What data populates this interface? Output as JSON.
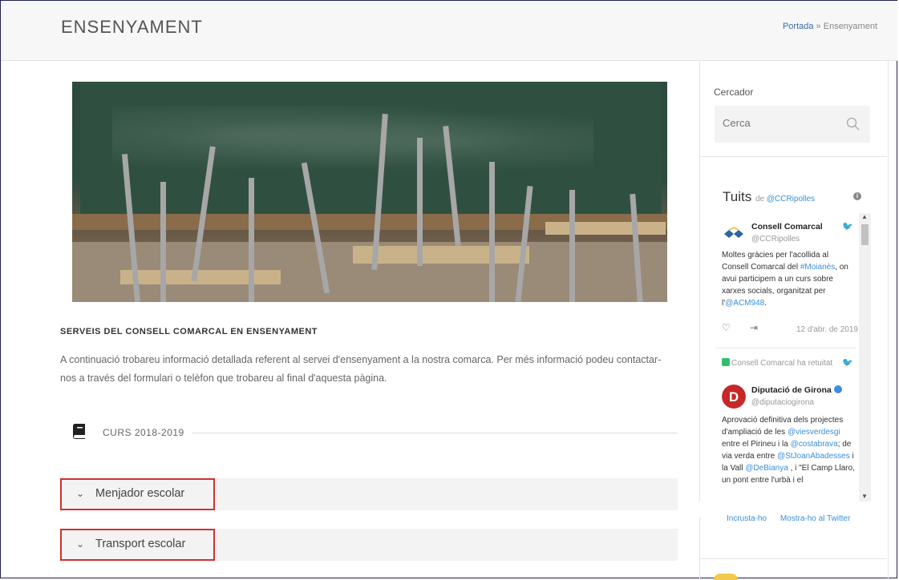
{
  "header": {
    "title": "ENSENYAMENT",
    "breadcrumb": {
      "home": "Portada",
      "separator": "»",
      "current": "Ensenyament"
    }
  },
  "main": {
    "section_heading": "SERVEIS DEL CONSELL COMARCAL EN ENSENYAMENT",
    "intro": "A continuació trobareu informació detallada referent al servei d'ensenyament a la nostra comarca. Per més informació podeu contactar-nos a través del formulari o telèfon que trobareu al final d'aquesta pàgina.",
    "course_label": "CURS 2018-2019",
    "accordion": [
      {
        "label": "Menjador escolar"
      },
      {
        "label": "Transport escolar"
      }
    ]
  },
  "sidebar": {
    "search": {
      "title": "Cercador",
      "placeholder": "Cerca"
    },
    "twitter": {
      "title": "Tuits",
      "by": "de",
      "handle": "@CCRipolles",
      "tweets": [
        {
          "name": "Consell Comarcal",
          "handle": "@CCRipolles",
          "text_a": "Moltes gràcies per l'acollida al Consell Comarcal del ",
          "hashtag": "#Moianès",
          "text_b": ", on avui participem a un curs sobre xarxes socials, organitzat per l'",
          "mention": "@ACM948",
          "text_c": ".",
          "date": "12 d'abr. de 2019"
        },
        {
          "retweet": "Consell Comarcal ha retuitat",
          "name": "Diputació de Girona",
          "handle": "@diputaciogirona",
          "t1": "Aprovació definitiva dels projectes d'ampliació de les ",
          "m1": "@viesverdesgi",
          "t2": " entre el Pirineu i la ",
          "m2": "@costabrava",
          "t3": "; de via verda entre ",
          "m3": "@StJoanAbadesses",
          "t4": " i la Vall ",
          "m4": "@DeBianya",
          "t5": " , i \"El Camp Llaro, un pont entre l'urbà i el"
        }
      ],
      "footer": {
        "embed": "Incrusta-ho",
        "view": "Mostra-ho al Twitter"
      }
    }
  },
  "colors": {
    "accent_red": "#d32f2f",
    "twitter_blue": "#3a8fd5",
    "link_blue": "#3a6ea5"
  }
}
